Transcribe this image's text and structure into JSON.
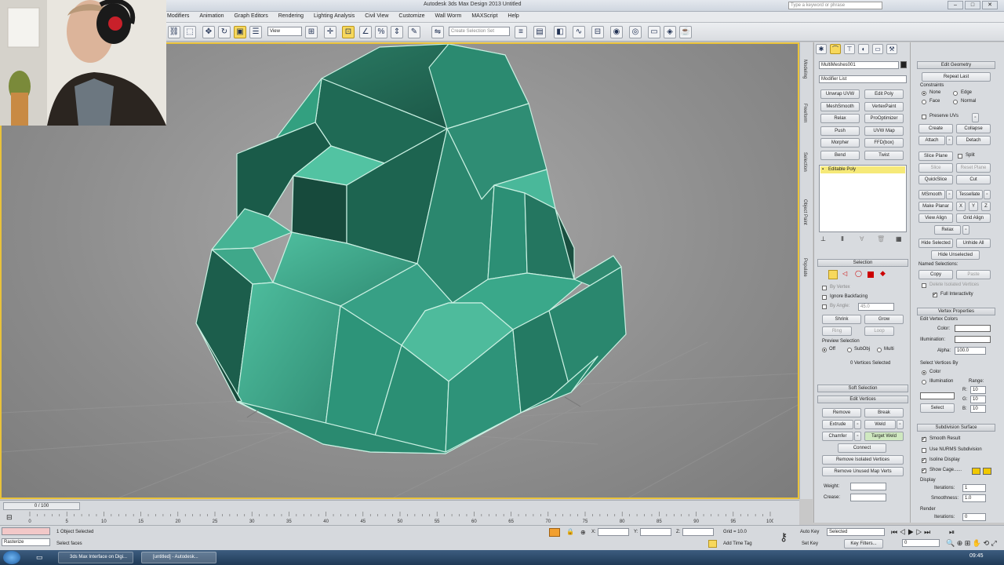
{
  "window": {
    "title": "Autodesk 3ds Max Design 2013    Untitled",
    "search_placeholder": "Type a keyword or phrase"
  },
  "menu": [
    "Modifiers",
    "Animation",
    "Graph Editors",
    "Rendering",
    "Lighting Analysis",
    "Civil View",
    "Customize",
    "Wall Worm",
    "MAXScript",
    "Help"
  ],
  "toolbar": {
    "selection_filter": "View",
    "named_selection_set": "Create Selection Set"
  },
  "side_tabs": [
    "Modeling",
    "Freeform",
    "Selection",
    "Object Paint",
    "Populate"
  ],
  "command_panel": {
    "object_name": "MultiMeshes001",
    "modifier_list": "Modifier List",
    "modifier_buttons": [
      "Unwrap UVW",
      "Edit Poly",
      "MeshSmooth",
      "VertexPaint",
      "Relax",
      "ProOptimizer",
      "Push",
      "UVW Map",
      "Morpher",
      "FFD(box)",
      "Bend",
      "Twist"
    ],
    "stack_item": "Editable Poly",
    "selection": {
      "title": "Selection",
      "by_vertex": "By Vertex",
      "ignore_backfacing": "Ignore Backfacing",
      "by_angle": "By Angle:",
      "by_angle_value": "45.0",
      "shrink": "Shrink",
      "grow": "Grow",
      "ring": "Ring",
      "loop": "Loop",
      "preview_selection": "Preview Selection",
      "preview_off": "Off",
      "preview_subobj": "SubObj",
      "preview_multi": "Multi",
      "status": "0 Vertices Selected"
    },
    "soft_selection": "Soft Selection",
    "edit_vertices": {
      "title": "Edit Vertices",
      "remove": "Remove",
      "break": "Break",
      "extrude": "Extrude",
      "weld": "Weld",
      "chamfer": "Chamfer",
      "target_weld": "Target Weld",
      "connect": "Connect",
      "remove_isolated": "Remove Isolated Vertices",
      "remove_unused": "Remove Unused Map Verts",
      "weight": "Weight:",
      "crease": "Crease:"
    }
  },
  "ribbon": {
    "edit_geometry": {
      "title": "Edit Geometry",
      "repeat_last": "Repeat Last",
      "constraints": "Constraints",
      "none": "None",
      "edge": "Edge",
      "face": "Face",
      "normal": "Normal",
      "preserve_uvs": "Preserve UVs",
      "create": "Create",
      "collapse": "Collapse",
      "attach": "Attach",
      "detach": "Detach",
      "slice_plane": "Slice Plane",
      "split": "Split",
      "slice": "Slice",
      "reset_plane": "Reset Plane",
      "quickslice": "QuickSlice",
      "cut": "Cut",
      "msmooth": "MSmooth",
      "tessellate": "Tessellate",
      "make_planar": "Make Planar",
      "x": "X",
      "y": "Y",
      "z": "Z",
      "view_align": "View Align",
      "grid_align": "Grid Align",
      "relax": "Relax",
      "hide_selected": "Hide Selected",
      "unhide_all": "Unhide All",
      "hide_unselected": "Hide Unselected",
      "named_selections": "Named Selections:",
      "copy": "Copy",
      "paste": "Paste",
      "delete_isolated": "Delete Isolated Vertices",
      "full_interactivity": "Full Interactivity"
    },
    "vertex_properties": {
      "title": "Vertex Properties",
      "edit_vertex_colors": "Edit Vertex Colors",
      "color": "Color:",
      "illumination": "Illumination:",
      "alpha": "Alpha:",
      "alpha_value": "100.0",
      "select_vertices_by": "Select Vertices By",
      "color_opt": "Color",
      "illumination_opt": "Illumination",
      "range": "Range:",
      "r": "R:",
      "g": "G:",
      "b": "B:",
      "range_value": "10",
      "select": "Select"
    },
    "subdivision_surface": {
      "title": "Subdivision Surface",
      "smooth_result": "Smooth Result",
      "use_nurms": "Use NURMS Subdivision",
      "isoline_display": "Isoline Display",
      "show_cage": "Show Cage......",
      "display": "Display",
      "iterations": "Iterations:",
      "iterations_value": "1",
      "smoothness": "Smoothness:",
      "smoothness_value": "1.0",
      "render": "Render",
      "render_iterations": "Iterations:",
      "render_iterations_value": "0"
    }
  },
  "timeline": {
    "slider": "0 / 100",
    "ticks": [
      "0",
      "5",
      "10",
      "15",
      "20",
      "25",
      "30",
      "35",
      "40",
      "45",
      "50",
      "55",
      "60",
      "65",
      "70",
      "75",
      "80",
      "85",
      "90",
      "95",
      "100"
    ]
  },
  "status": {
    "maxscript": "Rasterize",
    "objects_selected": "1 Object Selected",
    "prompt": "Select faces",
    "x_label": "X:",
    "y_label": "Y:",
    "z_label": "Z:",
    "grid": "Grid = 10.0",
    "add_time_tag": "Add Time Tag",
    "auto_key": "Auto Key",
    "auto_key_value": "Selected",
    "set_key": "Set Key",
    "key_filters": "Key Filters...",
    "frame": "0"
  },
  "taskbar": {
    "tasks": [
      "3ds Max Interface on Digi...",
      "[untitled] - Autodesk..."
    ],
    "clock": "09:45"
  },
  "colors": {
    "mesh_light": "#3fa38a",
    "mesh_dark": "#1c5e4c",
    "viewport_border": "#e9c23a",
    "active_button": "#f7d85c"
  }
}
